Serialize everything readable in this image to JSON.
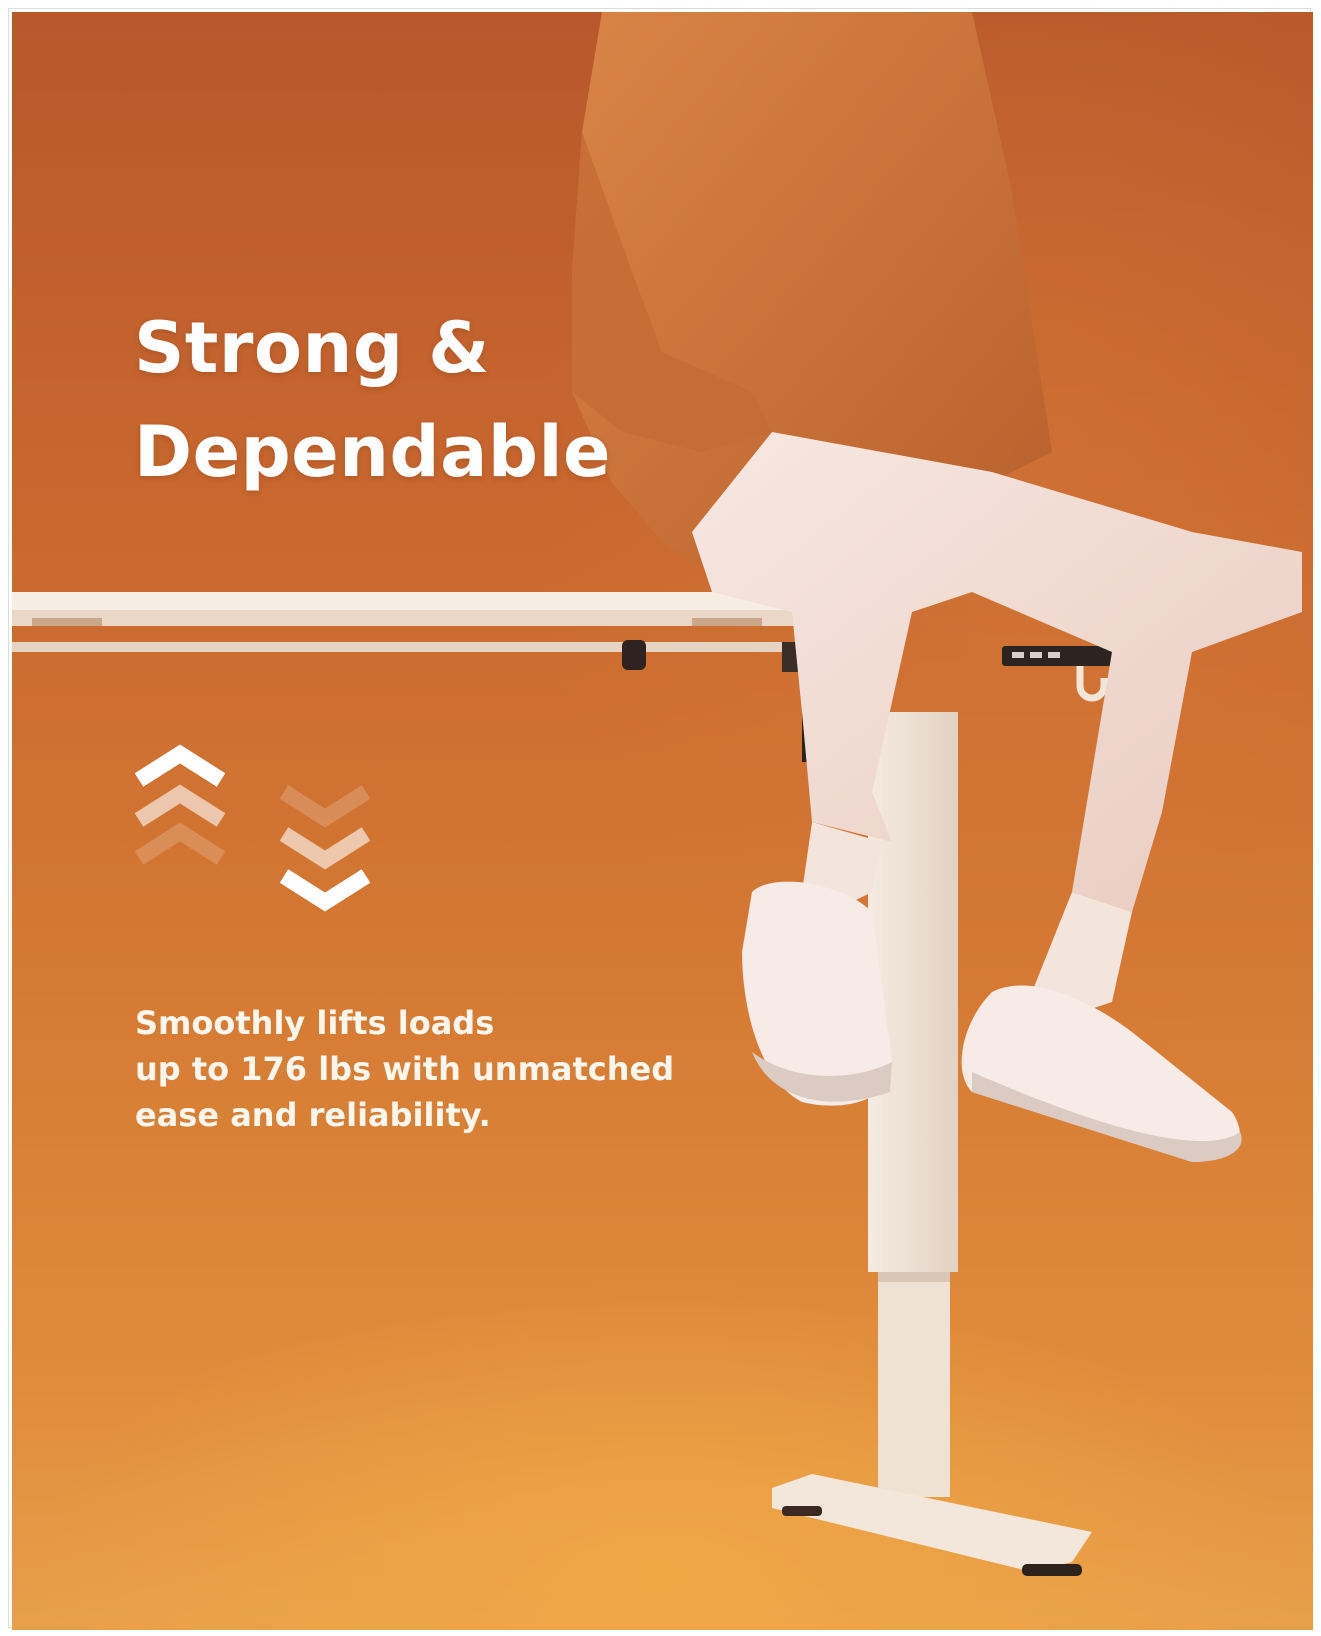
{
  "headline": {
    "line1": "Strong &",
    "line2": "Dependable"
  },
  "body": {
    "line1": "Smoothly lifts loads",
    "line2": "up to 176 lbs with unmatched",
    "line3": "ease and reliability."
  },
  "icons": [
    "chevrons-up-icon",
    "chevrons-down-icon"
  ],
  "colors": {
    "background_top": "#b8582c",
    "background_bottom": "#e8a04a",
    "desk_frame": "#f1e6da",
    "text": "#ffffff"
  }
}
